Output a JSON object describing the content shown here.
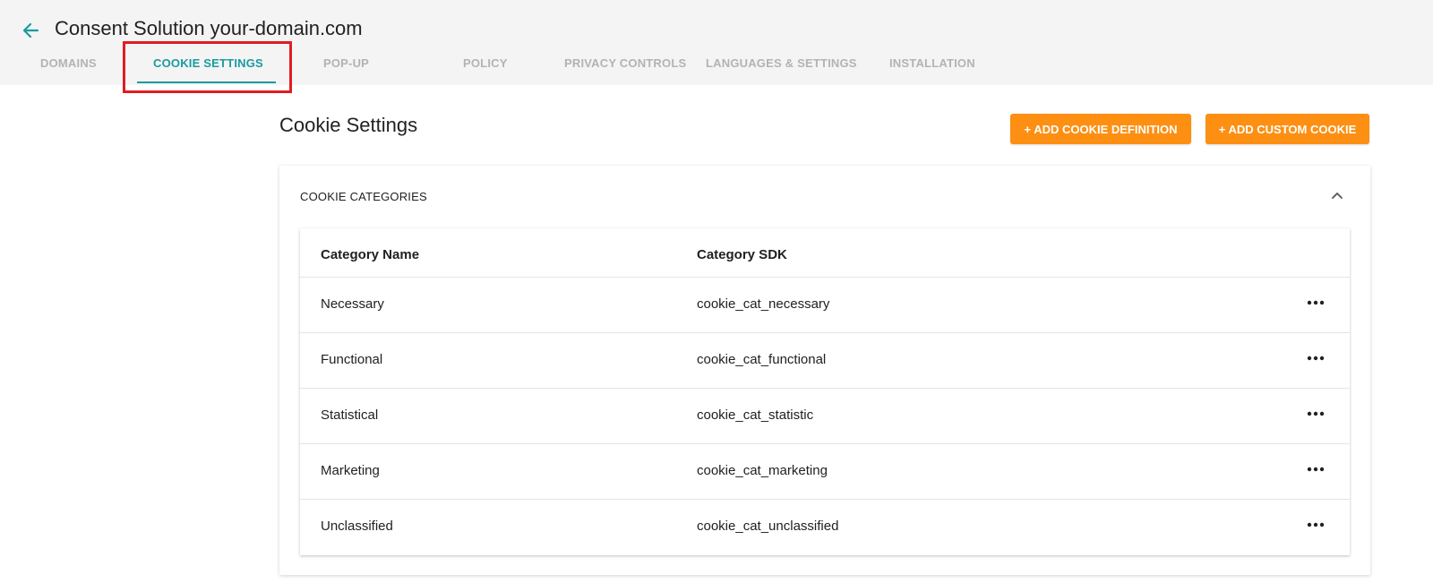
{
  "header": {
    "title": "Consent Solution your-domain.com",
    "back_icon": "arrow-left-icon",
    "accent_color": "#199ba0"
  },
  "tabs": [
    {
      "label": "DOMAINS",
      "active": false
    },
    {
      "label": "COOKIE SETTINGS",
      "active": true
    },
    {
      "label": "POP-UP",
      "active": false
    },
    {
      "label": "POLICY",
      "active": false
    },
    {
      "label": "PRIVACY CONTROLS",
      "active": false
    },
    {
      "label": "LANGUAGES & SETTINGS",
      "active": false
    },
    {
      "label": "INSTALLATION",
      "active": false
    }
  ],
  "page": {
    "title": "Cookie Settings",
    "add_definition_label": "+ ADD COOKIE DEFINITION",
    "add_custom_label": "+ ADD CUSTOM COOKIE",
    "button_color": "#fd8f12",
    "highlight_color": "#e11c22"
  },
  "categories_card": {
    "header_label": "COOKIE CATEGORIES",
    "collapse_icon": "chevron-up-icon",
    "columns": [
      "Category Name",
      "Category SDK"
    ],
    "rows": [
      {
        "name": "Necessary",
        "sdk": "cookie_cat_necessary"
      },
      {
        "name": "Functional",
        "sdk": "cookie_cat_functional"
      },
      {
        "name": "Statistical",
        "sdk": "cookie_cat_statistic"
      },
      {
        "name": "Marketing",
        "sdk": "cookie_cat_marketing"
      },
      {
        "name": "Unclassified",
        "sdk": "cookie_cat_unclassified"
      }
    ],
    "row_menu_icon": "more-horizontal-icon"
  }
}
